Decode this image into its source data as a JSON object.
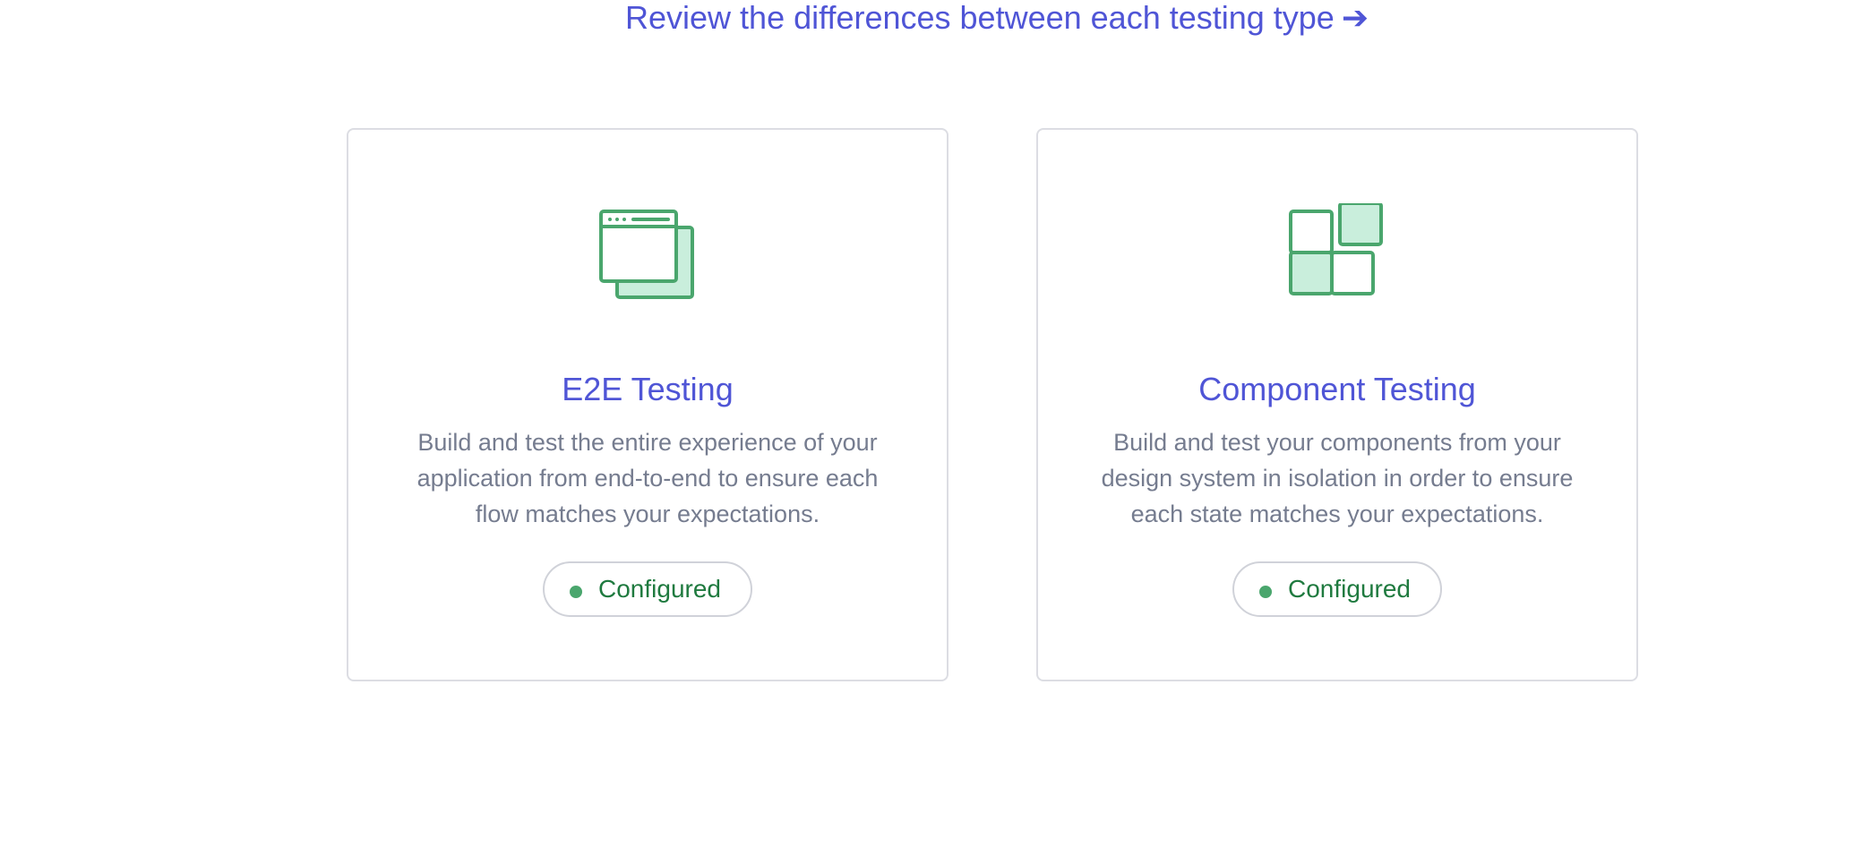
{
  "header": {
    "review_link": "Review the differences between each testing type",
    "review_arrow": "➔"
  },
  "cards": [
    {
      "id": "e2e",
      "icon": "browser-windows-icon",
      "title": "E2E Testing",
      "description": "Build and test the entire experience of your application from end-to-end to ensure each flow matches your expectations.",
      "status": "Configured"
    },
    {
      "id": "component",
      "icon": "component-blocks-icon",
      "title": "Component Testing",
      "description": "Build and test your components from your design system in isolation in order to ensure each state matches your expectations.",
      "status": "Configured"
    }
  ],
  "colors": {
    "accent": "#4f55d6",
    "icon_green": "#4aa66d",
    "icon_fill": "#c9eedc",
    "status_text": "#1f7a3f",
    "body_text": "#757c8f",
    "border": "#dcdde3"
  }
}
